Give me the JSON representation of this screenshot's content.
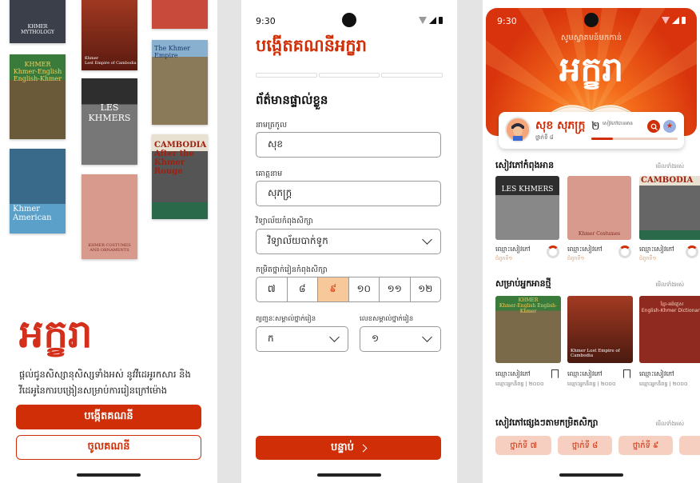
{
  "status": {
    "time": "9:30"
  },
  "onboarding": {
    "logo": "អក្ខរា",
    "description": "ផ្តល់ជូនសិស្សានុសិស្សទាំងអស់ នូវវីដេអូរកសារ និងវីដេអូនៃការបង្រៀនសម្រាប់ការរៀនក្រៅម៉ោង",
    "create_account": "បង្កើតគណនី",
    "login": "ចូលគណនី",
    "books": [
      {
        "title": "KHMER MYTHOLOGY"
      },
      {
        "title": "Khmer\nLost Empire of Cambodia"
      },
      {
        "title": "KHMER\nKhmer-English English-Khmer"
      },
      {
        "title": "LES KHMERS"
      },
      {
        "title": "The Khmer Empire"
      },
      {
        "title": "Khmer American"
      },
      {
        "title": "KHMER COSTUMES AND ORNAMENTS"
      },
      {
        "title": "CAMBODIA\nAfter the Khmer Rouge"
      }
    ]
  },
  "register": {
    "title": "បង្កើតគណនីអក្ខរា",
    "section": "ព័ត៌មានផ្ទាល់ខ្លួន",
    "last_name_label": "នាមត្រកូល",
    "last_name_value": "សុខ",
    "first_name_label": "គោត្តនាម",
    "first_name_value": "សុភក្ត្រ",
    "school_label": "វិទ្យាល័យកំពុងសិក្សា",
    "school_value": "វិទ្យាល័យបាក់ទូក",
    "grade_label": "កម្រិតថ្នាក់រៀនកំពុងសិក្សា",
    "grades": [
      "៧",
      "៨",
      "៩",
      "១០",
      "១១",
      "១២"
    ],
    "selected_grade": "៩",
    "class_letter_label": "ព្យញ្ជនៈសម្គាល់ថ្នាក់រៀន",
    "class_letter_value": "ក",
    "class_number_label": "លេខសម្គាល់ថ្នាក់រៀន",
    "class_number_value": "១",
    "next_button": "បន្ទាប់"
  },
  "home": {
    "welcome": "សូមស្វាគមន៍មកកាន់",
    "logo": "អក្ខរា",
    "user_name": "សុខ សុភក្ត្រ",
    "user_grade": "ថ្នាក់ទី ៨",
    "books_count": "២",
    "books_caption": "សៀវភៅបានអាន",
    "reading_progress": 0.25,
    "see_all": "មើលទាំងអស់",
    "reading_section": "សៀវភៅកំពុងអាន",
    "recommended_section": "សម្រាប់អ្នកអានថ្មី",
    "by_grade_section": "សៀវភៅផ្សេងៗតាមកម្រិតសិក្សា",
    "book_name": "ឈ្មោះសៀវភៅ",
    "reading_meta": "ជំពូកទី១",
    "recommended_meta": "ឈ្មោះអ្នកនិពន្ធ | ២០០០",
    "reading_books": [
      {
        "title": "LES KHMERS"
      },
      {
        "title": "Khmer Costumes"
      },
      {
        "title": "CAMBODIA"
      }
    ],
    "recommended_books": [
      {
        "title": "KHMER\nKhmer-English English-Khmer"
      },
      {
        "title": "Khmer Lost Empire of Cambodia"
      },
      {
        "title": "ខ្មែរ-អង់គ្លេស\nEnglish-Khmer Dictionary"
      }
    ],
    "grade_pills": [
      "ថ្នាក់ទី ៧",
      "ថ្នាក់ទី ៨",
      "ថ្នាក់ទី ៩"
    ]
  }
}
